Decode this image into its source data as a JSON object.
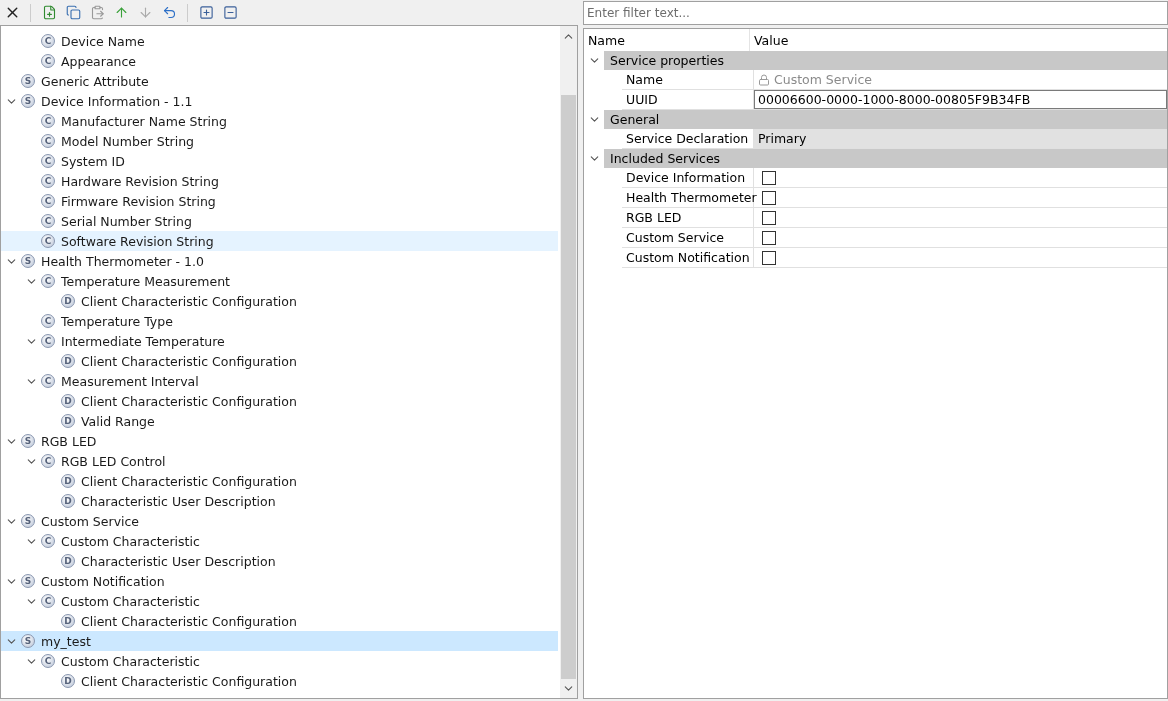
{
  "toolbar": {
    "filter": {
      "placeholder": "Enter filter text..."
    }
  },
  "tree": [
    {
      "children": [
        {
          "icon": "C",
          "label": "Device Name",
          "selected": false,
          "hovered": false
        },
        {
          "icon": "C",
          "label": "Appearance",
          "selected": false,
          "hovered": false
        }
      ]
    },
    {
      "icon": "S",
      "label": "Generic Attribute",
      "selected": false,
      "hovered": false
    },
    {
      "icon": "S",
      "label": "Device Information - 1.1",
      "selected": false,
      "hovered": false,
      "expanded": true,
      "children": [
        {
          "icon": "C",
          "label": "Manufacturer Name String",
          "selected": false,
          "hovered": false
        },
        {
          "icon": "C",
          "label": "Model Number String",
          "selected": false,
          "hovered": false
        },
        {
          "icon": "C",
          "label": "System ID",
          "selected": false,
          "hovered": false
        },
        {
          "icon": "C",
          "label": "Hardware Revision String",
          "selected": false,
          "hovered": false
        },
        {
          "icon": "C",
          "label": "Firmware Revision String",
          "selected": false,
          "hovered": false
        },
        {
          "icon": "C",
          "label": "Serial Number String",
          "selected": false,
          "hovered": false
        },
        {
          "icon": "C",
          "label": "Software Revision String",
          "selected": false,
          "hovered": true
        }
      ]
    },
    {
      "icon": "S",
      "label": "Health Thermometer - 1.0",
      "selected": false,
      "hovered": false,
      "expanded": true,
      "children": [
        {
          "icon": "C",
          "label": "Temperature Measurement",
          "selected": false,
          "hovered": false,
          "expanded": true,
          "children": [
            {
              "icon": "D",
              "label": "Client Characteristic Configuration",
              "selected": false,
              "hovered": false
            }
          ]
        },
        {
          "icon": "C",
          "label": "Temperature Type",
          "selected": false,
          "hovered": false
        },
        {
          "icon": "C",
          "label": "Intermediate Temperature",
          "selected": false,
          "hovered": false,
          "expanded": true,
          "children": [
            {
              "icon": "D",
              "label": "Client Characteristic Configuration",
              "selected": false,
              "hovered": false
            }
          ]
        },
        {
          "icon": "C",
          "label": "Measurement Interval",
          "selected": false,
          "hovered": false,
          "expanded": true,
          "children": [
            {
              "icon": "D",
              "label": "Client Characteristic Configuration",
              "selected": false,
              "hovered": false
            },
            {
              "icon": "D",
              "label": "Valid Range",
              "selected": false,
              "hovered": false
            }
          ]
        }
      ]
    },
    {
      "icon": "S",
      "label": "RGB LED",
      "selected": false,
      "hovered": false,
      "expanded": true,
      "children": [
        {
          "icon": "C",
          "label": "RGB LED Control",
          "selected": false,
          "hovered": false,
          "expanded": true,
          "children": [
            {
              "icon": "D",
              "label": "Client Characteristic Configuration",
              "selected": false,
              "hovered": false
            },
            {
              "icon": "D",
              "label": "Characteristic User Description",
              "selected": false,
              "hovered": false
            }
          ]
        }
      ]
    },
    {
      "icon": "S",
      "label": "Custom Service",
      "selected": false,
      "hovered": false,
      "expanded": true,
      "children": [
        {
          "icon": "C",
          "label": "Custom Characteristic",
          "selected": false,
          "hovered": false,
          "expanded": true,
          "children": [
            {
              "icon": "D",
              "label": "Characteristic User Description",
              "selected": false,
              "hovered": false
            }
          ]
        }
      ]
    },
    {
      "icon": "S",
      "label": "Custom Notification",
      "selected": false,
      "hovered": false,
      "expanded": true,
      "children": [
        {
          "icon": "C",
          "label": "Custom Characteristic",
          "selected": false,
          "hovered": false,
          "expanded": true,
          "children": [
            {
              "icon": "D",
              "label": "Client Characteristic Configuration",
              "selected": false,
              "hovered": false
            }
          ]
        }
      ]
    },
    {
      "icon": "S",
      "label": "my_test",
      "selected": true,
      "hovered": false,
      "expanded": true,
      "children": [
        {
          "icon": "C",
          "label": "Custom Characteristic",
          "selected": false,
          "hovered": false,
          "expanded": true,
          "children": [
            {
              "icon": "D",
              "label": "Client Characteristic Configuration",
              "selected": false,
              "hovered": false
            }
          ]
        }
      ]
    }
  ],
  "properties": {
    "columns": [
      "Name",
      "Value"
    ],
    "groups": [
      {
        "title": "Service properties",
        "expanded": true,
        "rows": [
          {
            "kind": "locked",
            "name": "Name",
            "value": "Custom Service"
          },
          {
            "kind": "text",
            "name": "UUID",
            "value": "00006600-0000-1000-8000-00805F9B34FB"
          }
        ]
      },
      {
        "title": "General",
        "expanded": true,
        "rows": [
          {
            "kind": "select",
            "name": "Service Declaration",
            "value": "Primary"
          }
        ]
      },
      {
        "title": "Included Services",
        "expanded": true,
        "rows": [
          {
            "kind": "checkbox",
            "name": "Device Information",
            "checked": false
          },
          {
            "kind": "checkbox",
            "name": "Health Thermometer",
            "checked": false
          },
          {
            "kind": "checkbox",
            "name": "RGB LED",
            "checked": false
          },
          {
            "kind": "checkbox",
            "name": "Custom Service",
            "checked": false
          },
          {
            "kind": "checkbox",
            "name": "Custom Notification",
            "checked": false
          }
        ]
      }
    ]
  }
}
